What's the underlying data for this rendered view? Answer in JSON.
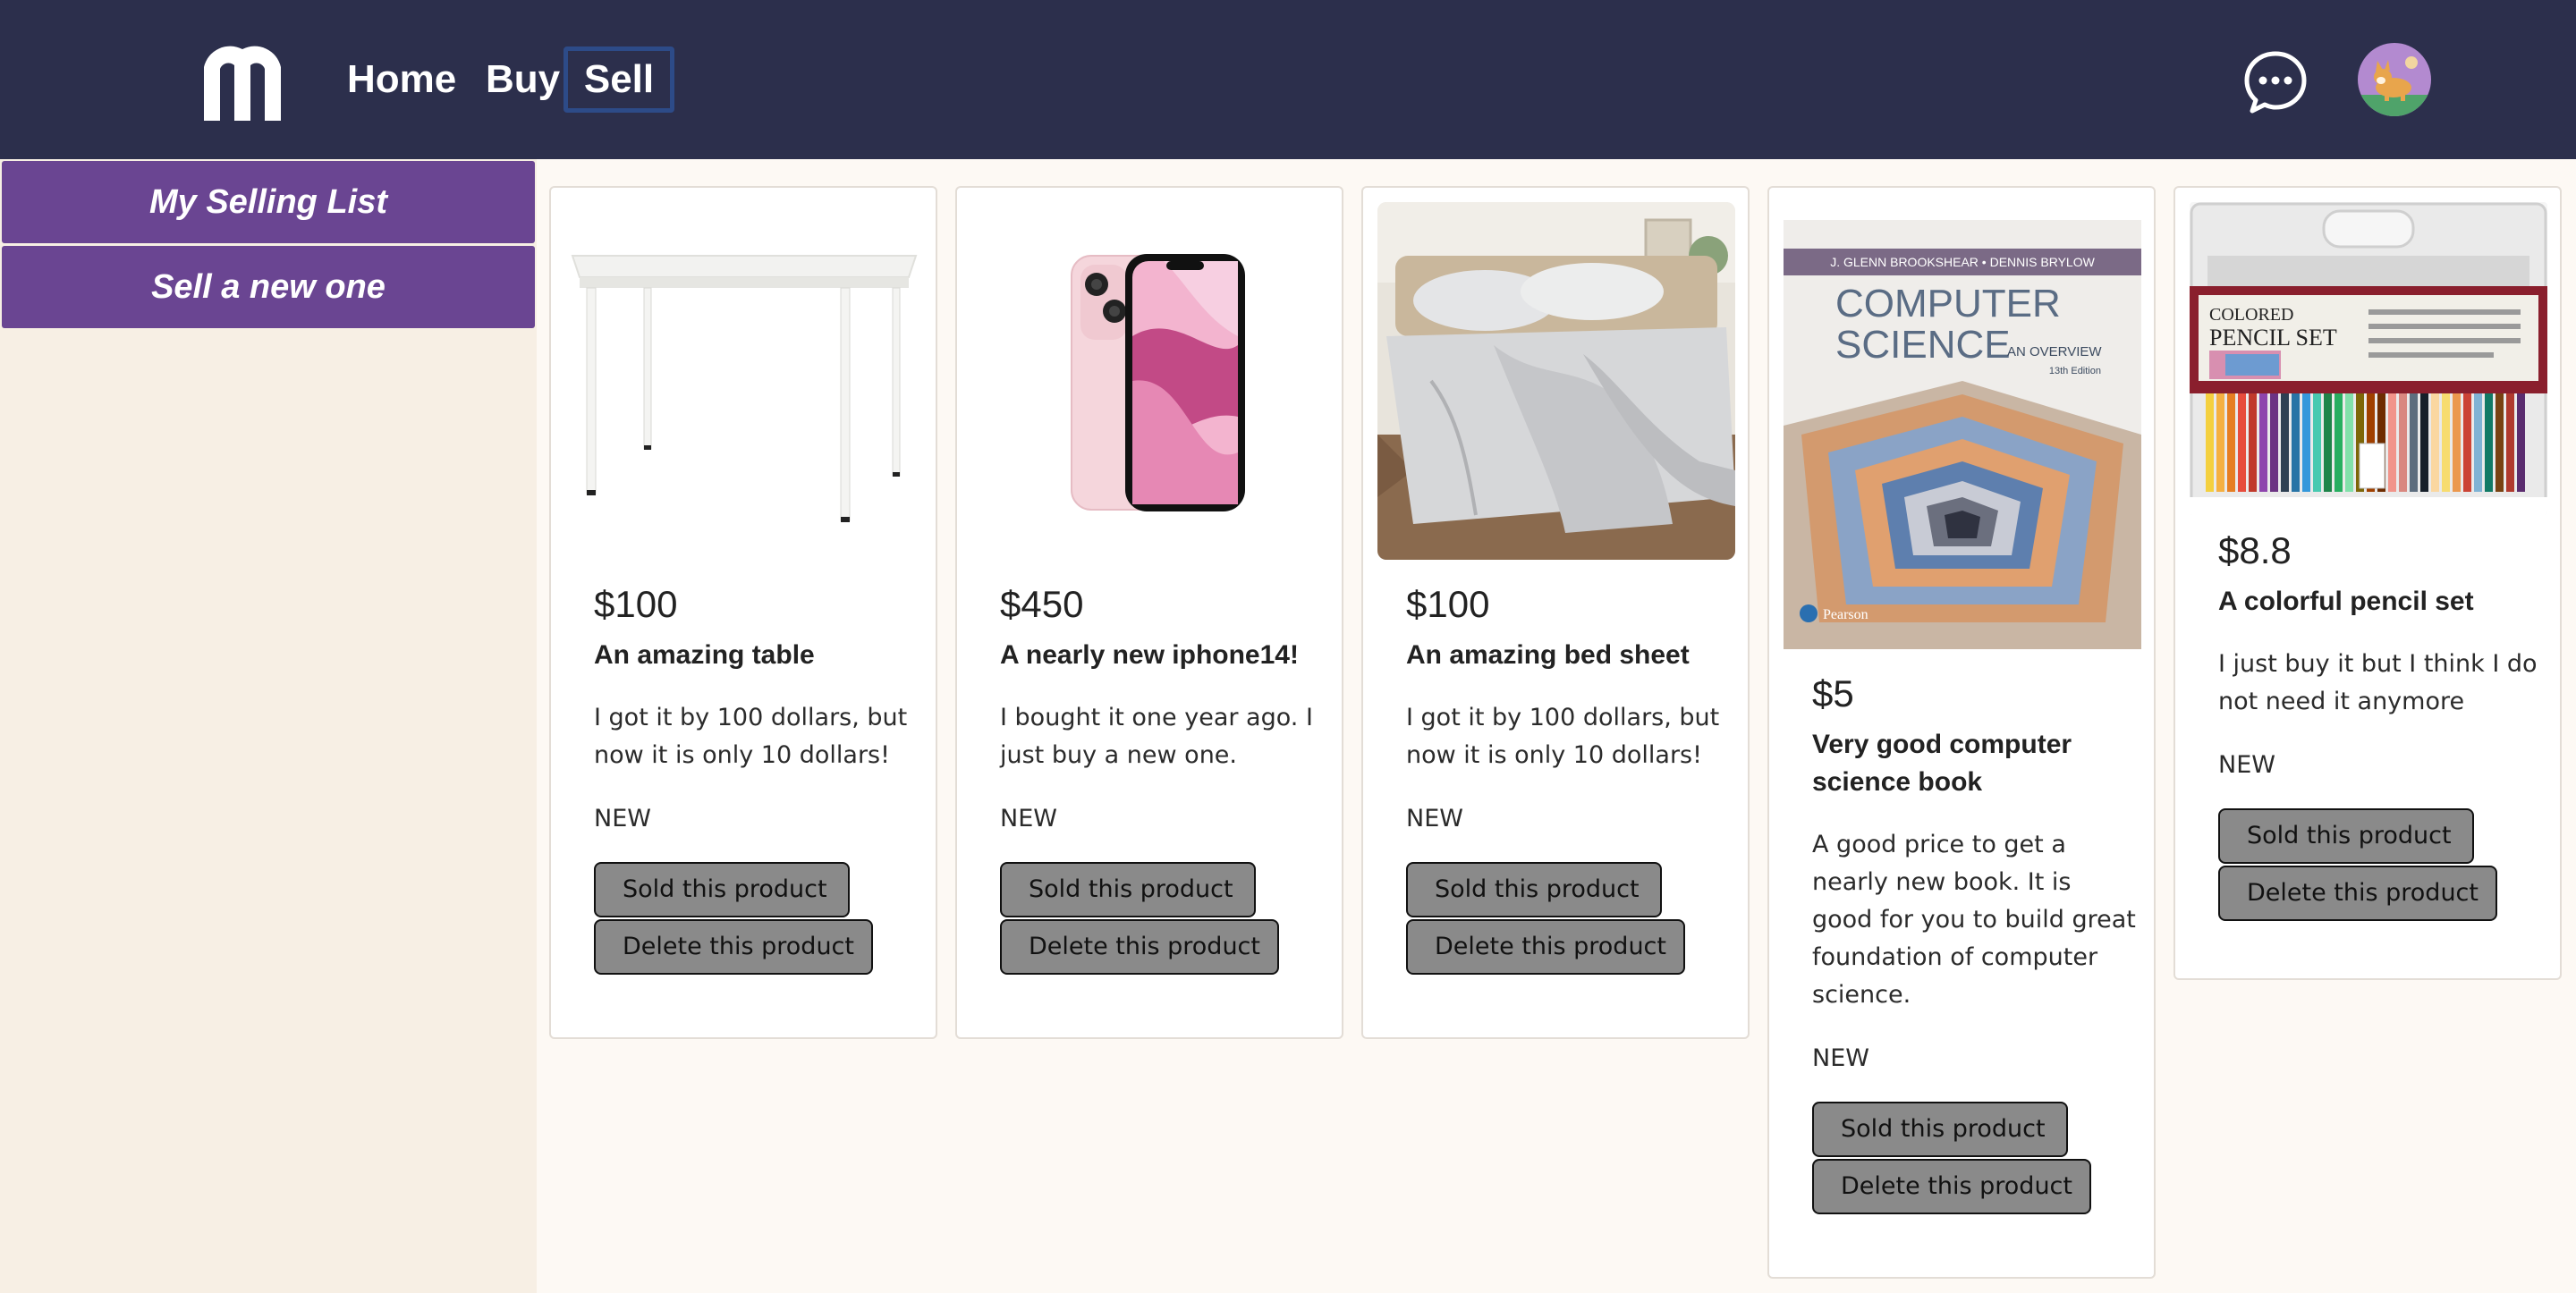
{
  "header": {
    "nav": {
      "home": "Home",
      "buy": "Buy",
      "sell": "Sell"
    },
    "icons": {
      "logo": "m-logo",
      "chat": "chat-bubble-icon",
      "avatar": "user-avatar"
    },
    "colors": {
      "background": "#2c2f4c",
      "active_border": "#2d4b88"
    }
  },
  "sidebar": {
    "items": [
      {
        "label": "My Selling List"
      },
      {
        "label": "Sell a new one"
      }
    ],
    "colors": {
      "button": "#6a4592"
    }
  },
  "products": [
    {
      "image": "white-table",
      "price": "$100",
      "title": "An amazing table",
      "description": "I got it by 100 dollars, but now it is only 10 dollars!",
      "condition": "NEW",
      "sold_label": "Sold this product",
      "delete_label": "Delete this product"
    },
    {
      "image": "pink-iphone",
      "price": "$450",
      "title": "A nearly new iphone14!",
      "description": "I bought it one year ago. I just buy a new one.",
      "condition": "NEW",
      "sold_label": "Sold this product",
      "delete_label": "Delete this product"
    },
    {
      "image": "bed-sheet",
      "price": "$100",
      "title": "An amazing bed sheet",
      "description": "I got it by 100 dollars, but now it is only 10 dollars!",
      "condition": "NEW",
      "sold_label": "Sold this product",
      "delete_label": "Delete this product"
    },
    {
      "image": "computer-science-book",
      "image_text": {
        "authors": "J. GLENN BROOKSHEAR • DENNIS BRYLOW",
        "title_line1": "COMPUTER",
        "title_line2": "SCIENCE",
        "subtitle": "AN OVERVIEW",
        "edition": "13th Edition",
        "publisher": "Pearson"
      },
      "price": "$5",
      "title": "Very good computer science book",
      "description": "A good price to get a nearly new book. It is good for you to build great foundation of computer science.",
      "condition": "NEW",
      "sold_label": "Sold this product",
      "delete_label": "Delete this product"
    },
    {
      "image": "colored-pencil-set",
      "image_text": {
        "line1": "COLORED",
        "line2": "PENCIL SET"
      },
      "price": "$8.8",
      "title": "A colorful pencil set",
      "description": "I just buy it but I think I do not need it anymore",
      "condition": "NEW",
      "sold_label": "Sold this product",
      "delete_label": "Delete this product"
    }
  ]
}
